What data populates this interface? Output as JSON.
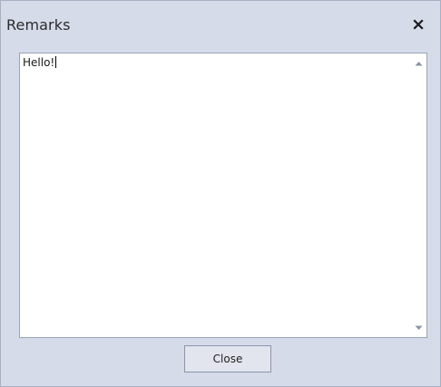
{
  "dialog": {
    "title": "Remarks",
    "close_icon": "close-x-icon",
    "remarks_text": "Hello!",
    "close_button_label": "Close"
  },
  "colors": {
    "dialog_background": "#d6dbe9",
    "text_area_background": "#ffffff",
    "button_background": "#e2e5ee"
  }
}
